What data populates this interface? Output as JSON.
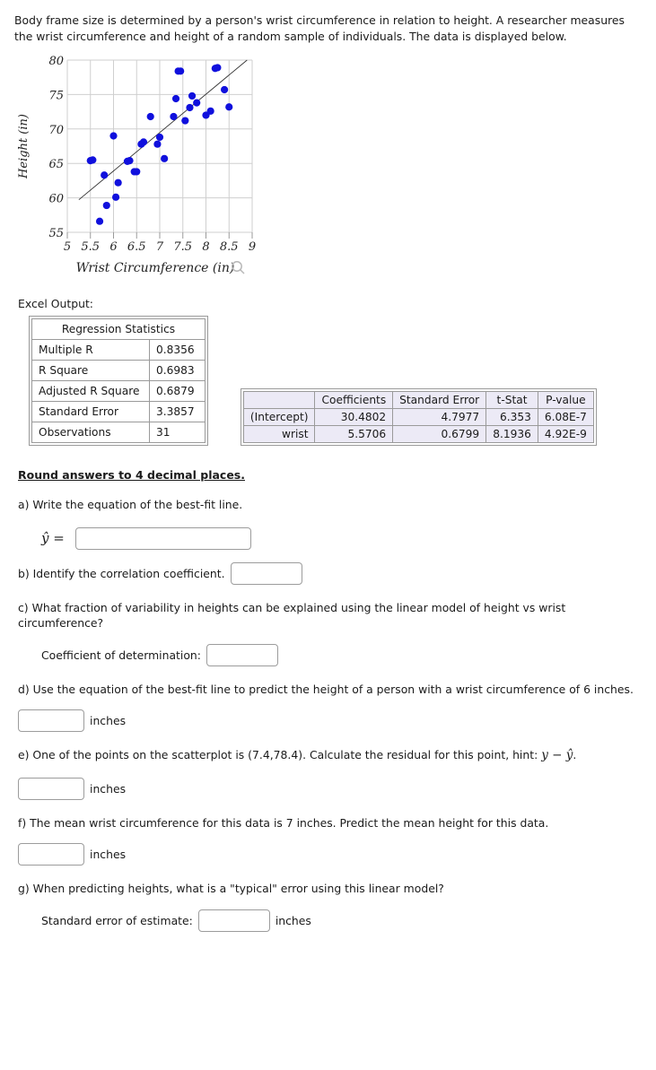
{
  "intro": "Body frame size is determined by a person's wrist circumference in relation to height. A researcher measures the wrist circumference and height of a random sample of individuals. The data is displayed below.",
  "chart_data": {
    "type": "scatter",
    "title": "",
    "xlabel": "Wrist Circumference (in)",
    "ylabel": "Height (in)",
    "xlim": [
      5,
      9
    ],
    "ylim": [
      55,
      80
    ],
    "xticks": [
      5,
      5.5,
      6,
      6.5,
      7,
      7.5,
      8,
      8.5,
      9
    ],
    "yticks": [
      55,
      60,
      65,
      70,
      75,
      80
    ],
    "grid": true,
    "legend": "none",
    "point_color": "#1010dd",
    "trendline": {
      "label": "best-fit line",
      "color": "#333333",
      "intercept": 30.4802,
      "slope": 5.5706,
      "x_start": 5.25,
      "x_end": 9.0
    },
    "points": [
      [
        5.5,
        65.4
      ],
      [
        5.55,
        65.5
      ],
      [
        5.7,
        56.6
      ],
      [
        5.8,
        63.3
      ],
      [
        5.85,
        58.9
      ],
      [
        6.0,
        69.0
      ],
      [
        6.05,
        60.1
      ],
      [
        6.1,
        62.2
      ],
      [
        6.3,
        65.3
      ],
      [
        6.35,
        65.4
      ],
      [
        6.45,
        63.8
      ],
      [
        6.5,
        63.8
      ],
      [
        6.6,
        67.8
      ],
      [
        6.65,
        68.1
      ],
      [
        6.8,
        71.8
      ],
      [
        6.95,
        67.8
      ],
      [
        7.0,
        68.8
      ],
      [
        7.1,
        65.7
      ],
      [
        7.3,
        71.8
      ],
      [
        7.35,
        74.4
      ],
      [
        7.4,
        78.4
      ],
      [
        7.45,
        78.4
      ],
      [
        7.55,
        71.2
      ],
      [
        7.65,
        73.1
      ],
      [
        7.7,
        74.8
      ],
      [
        7.8,
        73.8
      ],
      [
        8.0,
        72.0
      ],
      [
        8.1,
        72.6
      ],
      [
        8.2,
        78.8
      ],
      [
        8.25,
        78.9
      ],
      [
        8.4,
        75.7
      ],
      [
        8.5,
        73.2
      ]
    ]
  },
  "zoom_icon": "search-icon",
  "excel_label": "Excel Output:",
  "regression_stats": {
    "title": "Regression Statistics",
    "rows": [
      {
        "label": "Multiple R",
        "value": "0.8356"
      },
      {
        "label": "R Square",
        "value": "0.6983"
      },
      {
        "label": "Adjusted R Square",
        "value": "0.6879"
      },
      {
        "label": "Standard Error",
        "value": "3.3857"
      },
      {
        "label": "Observations",
        "value": "31"
      }
    ]
  },
  "coefficients_table": {
    "headers": [
      "",
      "Coefficients",
      "Standard Error",
      "t-Stat",
      "P-value"
    ],
    "rows": [
      {
        "name": "(Intercept)",
        "coefficient": "30.4802",
        "standard_error": "4.7977",
        "t_stat": "6.353",
        "p_value": "6.08E-7"
      },
      {
        "name": "wrist",
        "coefficient": "5.5706",
        "standard_error": "0.6799",
        "t_stat": "8.1936",
        "p_value": "4.92E-9"
      }
    ]
  },
  "round_note": "Round answers to 4 decimal places.",
  "questions": {
    "a": {
      "text": "a) Write the equation of the best-fit line.",
      "equation_symbol": "ŷ =",
      "input_value": "",
      "input_placeholder": ""
    },
    "b": {
      "text": "b) Identify the correlation coefficient.",
      "input_value": "",
      "input_placeholder": ""
    },
    "c": {
      "text": "c) What fraction of variability in heights can be explained using the linear model of height vs wrist circumference?",
      "sublabel": "Coefficient of determination:",
      "input_value": "",
      "input_placeholder": ""
    },
    "d": {
      "text": "d) Use the equation of the best-fit line to predict the height of a person with a wrist circumference of 6 inches.",
      "unit": "inches",
      "input_value": "",
      "input_placeholder": ""
    },
    "e": {
      "text_before": "e) One of the points on the scatterplot is (7.4,78.4). Calculate the residual for this point, hint:",
      "hint_formula": "y − ŷ",
      "text_after": ".",
      "unit": "inches",
      "input_value": "",
      "input_placeholder": ""
    },
    "f": {
      "text": "f) The mean wrist circumference for this data is 7 inches. Predict the mean height for this data.",
      "unit": "inches",
      "input_value": "",
      "input_placeholder": ""
    },
    "g": {
      "text": "g) When predicting heights, what is a \"typical\" error using this linear model?",
      "sublabel": "Standard error of estimate:",
      "unit": "inches",
      "input_value": "",
      "input_placeholder": ""
    }
  }
}
